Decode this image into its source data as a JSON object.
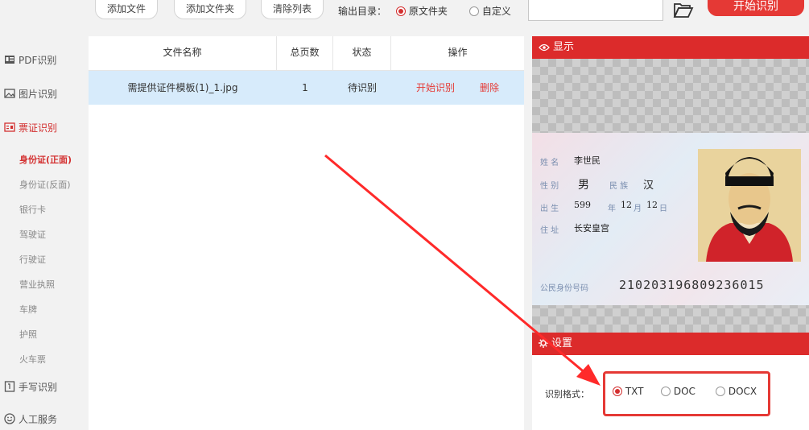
{
  "toolbar": {
    "add_file": "添加文件",
    "add_folder": "添加文件夹",
    "clear_list": "清除列表",
    "output_label": "输出目录：",
    "output_options": [
      "原文件夹",
      "自定义"
    ],
    "output_selected": "原文件夹",
    "path_value": "",
    "start_button": "开始识别"
  },
  "sidebar": {
    "items": [
      {
        "label": "PDF识别",
        "icon": "pdf-icon"
      },
      {
        "label": "图片识别",
        "icon": "image-icon"
      },
      {
        "label": "票证识别",
        "icon": "card-icon",
        "active": true
      },
      {
        "label": "手写识别",
        "icon": "handwriting-icon"
      },
      {
        "label": "人工服务",
        "icon": "smiley-icon"
      }
    ],
    "sub_items": [
      "身份证(正面)",
      "身份证(反面)",
      "银行卡",
      "驾驶证",
      "行驶证",
      "营业执照",
      "车牌",
      "护照",
      "火车票"
    ],
    "sub_active": "身份证(正面)"
  },
  "table": {
    "headers": [
      "文件名称",
      "总页数",
      "状态",
      "操作"
    ],
    "rows": [
      {
        "name": "需提供证件模板(1)_1.jpg",
        "pages": "1",
        "status": "待识别",
        "action_start": "开始识别",
        "action_delete": "删除"
      }
    ]
  },
  "preview": {
    "title": "显示",
    "id_card": {
      "name_label": "姓 名",
      "name": "李世民",
      "sex_label": "性 别",
      "sex": "男",
      "ethnic_label": "民 族",
      "ethnic": "汉",
      "birth_label": "出 生",
      "birth_year": "599",
      "birth_year_unit": "年",
      "birth_month": "12",
      "birth_month_unit": "月",
      "birth_day": "12",
      "birth_day_unit": "日",
      "address_label": "住 址",
      "address": "长安皇宫",
      "id_label": "公民身份号码",
      "id_number": "210203196809236015"
    }
  },
  "settings": {
    "title": "设置",
    "format_label": "识别格式：",
    "formats": [
      "TXT",
      "DOC",
      "DOCX"
    ],
    "format_selected": "TXT"
  },
  "colors": {
    "accent": "#e53935",
    "panel_header": "#dc2b2b",
    "row_highlight": "#d7ebfb"
  }
}
